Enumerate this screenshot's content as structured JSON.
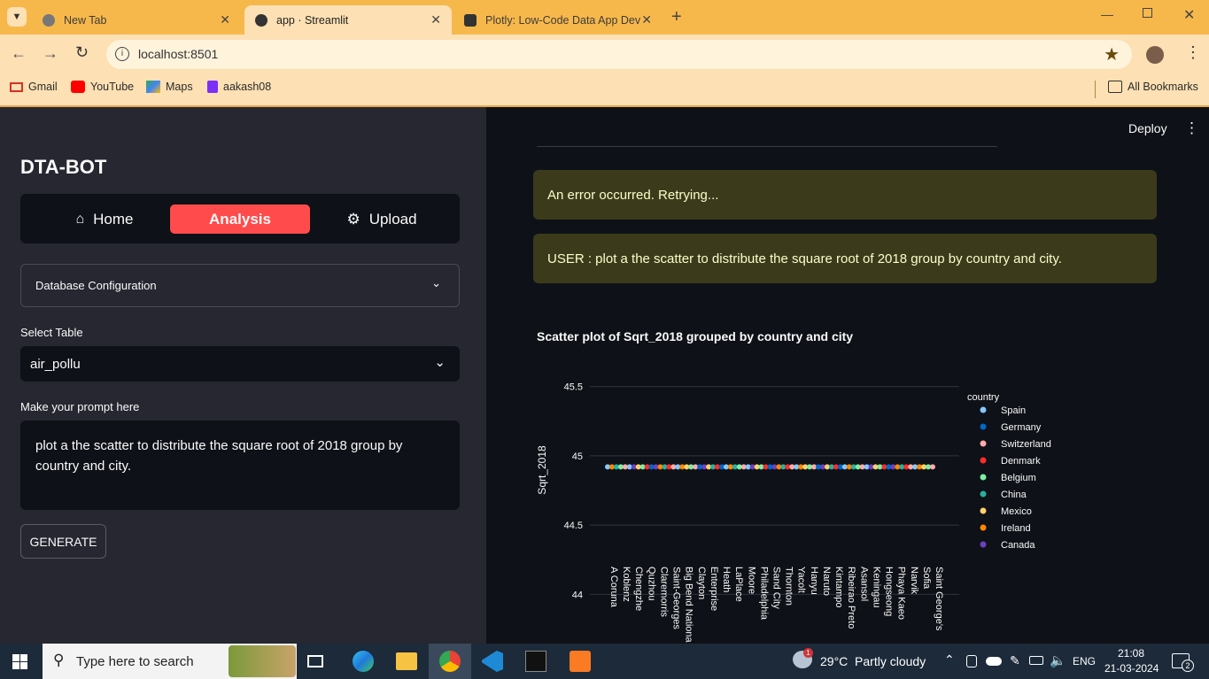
{
  "browser": {
    "tabs": [
      {
        "title": "New Tab",
        "active": false
      },
      {
        "title": "app · Streamlit",
        "active": true
      },
      {
        "title": "Plotly: Low-Code Data App Dev",
        "active": false
      }
    ],
    "url": "localhost:8501",
    "bookmarks": [
      "Gmail",
      "YouTube",
      "Maps",
      "aakash08"
    ],
    "all_bookmarks": "All Bookmarks"
  },
  "sidebar": {
    "title": "DTA-BOT",
    "nav": [
      {
        "label": "Home",
        "icon": "home-icon"
      },
      {
        "label": "Analysis",
        "icon": "",
        "active": true
      },
      {
        "label": "Upload",
        "icon": "gear-icon"
      }
    ],
    "expander_label": "Database Configuration",
    "select_label": "Select Table",
    "select_value": "air_pollu",
    "prompt_label": "Make your prompt here",
    "prompt_value": "plot a the scatter to distribute the square root of  2018 group by country and city.",
    "generate_label": "GENERATE"
  },
  "main": {
    "deploy_label": "Deploy",
    "error_message": "An error occurred. Retrying...",
    "user_message": "USER : plot a the scatter to distribute the square root of 2018 group by country and city."
  },
  "chart_data": {
    "type": "scatter",
    "title": "Scatter plot of Sqrt_2018 grouped by country and city",
    "ylabel": "Sqrt_2018",
    "xlabel": "",
    "ylim": [
      43.9,
      45.6
    ],
    "yticks": [
      "45.5",
      "45",
      "44.5",
      "44"
    ],
    "ytick_values": [
      45.5,
      45,
      44.5,
      44
    ],
    "categories": [
      "A Coruna",
      "Koblenz",
      "Chengzhe",
      "Quzhou",
      "Claremorris",
      "Saint-Georges",
      "Big Bend Nationa",
      "Clayton",
      "Enterprise",
      "Heath",
      "LaPlace",
      "Moore",
      "Philadelphia",
      "Sand City",
      "Thornton",
      "Yacolt",
      "Hanyu",
      "Naruto",
      "Kintampo",
      "Ribeirao Preto",
      "Asansol",
      "Keningau",
      "Hongseong",
      "Phaya Kaeo",
      "Narvik",
      "Sofia",
      "Saint George's"
    ],
    "point_value": 44.92,
    "legend_title": "country",
    "series": [
      {
        "name": "Spain",
        "color": "#83c9ff"
      },
      {
        "name": "Germany",
        "color": "#0068c9"
      },
      {
        "name": "Switzerland",
        "color": "#ffabab"
      },
      {
        "name": "Denmark",
        "color": "#ff2b2b"
      },
      {
        "name": "Belgium",
        "color": "#7defa1"
      },
      {
        "name": "China",
        "color": "#29b09d"
      },
      {
        "name": "Mexico",
        "color": "#ffd16a"
      },
      {
        "name": "Ireland",
        "color": "#ff8700"
      },
      {
        "name": "Canada",
        "color": "#6d3fc0"
      }
    ]
  },
  "taskbar": {
    "search_placeholder": "Type here to search",
    "weather": "29°C  Partly cloudy",
    "weather_badge": "1",
    "lang": "ENG",
    "time": "21:08",
    "date": "21-03-2024",
    "notifications": "2"
  }
}
